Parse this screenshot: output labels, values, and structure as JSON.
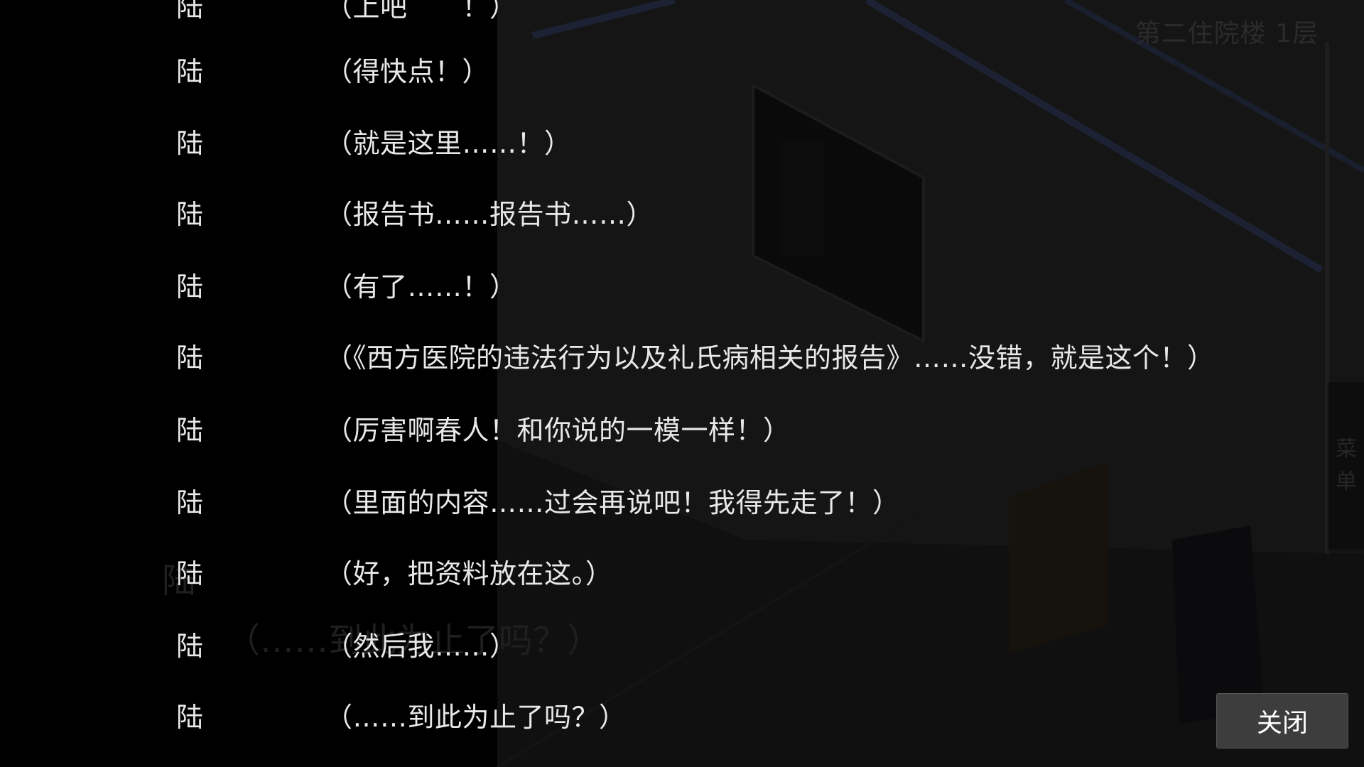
{
  "scene": {
    "location": "第二住院楼 1层",
    "side_menu": [
      "菜",
      "单"
    ],
    "dialogue_speaker": "陆",
    "dialogue_text": "（……到此为止了吗？）"
  },
  "backlog": {
    "entries": [
      {
        "speaker": "陆",
        "text": "（上吧　　！）"
      },
      {
        "speaker": "陆",
        "text": "（得快点！）"
      },
      {
        "speaker": "陆",
        "text": "（就是这里……！）"
      },
      {
        "speaker": "陆",
        "text": "（报告书……报告书……）"
      },
      {
        "speaker": "陆",
        "text": "（有了……！）"
      },
      {
        "speaker": "陆",
        "text": "（《西方医院的违法行为以及礼氏病相关的报告》……没错，就是这个！）"
      },
      {
        "speaker": "陆",
        "text": "（厉害啊春人！和你说的一模一样！）"
      },
      {
        "speaker": "陆",
        "text": "（里面的内容……过会再说吧！我得先走了！）"
      },
      {
        "speaker": "陆",
        "text": "（好，把资料放在这。）"
      },
      {
        "speaker": "陆",
        "text": "（然后我……）"
      },
      {
        "speaker": "陆",
        "text": "（……到此为止了吗？）"
      }
    ],
    "close_label": "关闭"
  },
  "colors": {
    "background": "#000000",
    "text": "#e8e8e8",
    "button": "#3d3d3d"
  }
}
